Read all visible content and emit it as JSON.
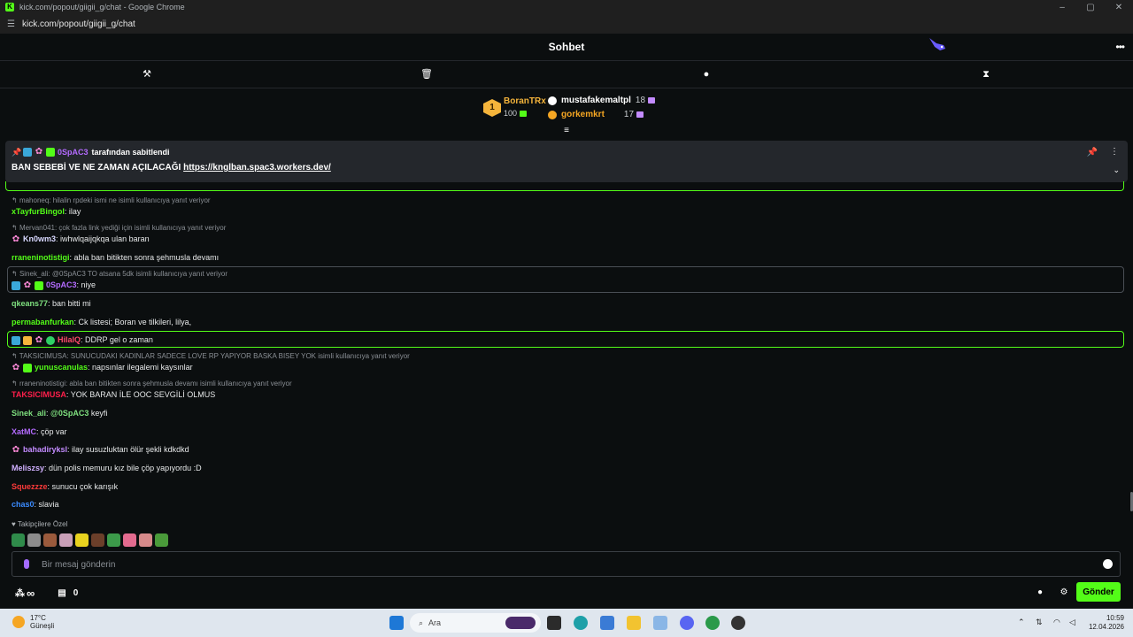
{
  "browser": {
    "window_title": "kick.com/popout/giigii_g/chat - Google Chrome",
    "url": "kick.com/popout/giigii_g/chat",
    "window_buttons": [
      "–",
      "▢",
      "✕"
    ]
  },
  "header": {
    "title": "Sohbet"
  },
  "leaderboard": {
    "first": {
      "rank": "1",
      "name": "BoranTRx",
      "value": "100"
    },
    "others": [
      {
        "name": "mustafakemaltpl",
        "value": "18",
        "color": "#ffffff"
      },
      {
        "name": "gorkemkrt",
        "value": "17",
        "color": "#f5a623"
      }
    ]
  },
  "pinned": {
    "pinner": "0SpAC3",
    "pinned_by_suffix": "tarafından sabitlendi",
    "text": "BAN SEBEBİ VE NE ZAMAN AÇILACAĞI",
    "link": "https://knglban.spac3.workers.dev/"
  },
  "messages": [
    {
      "reply": "mahoneq: hilalin rpdeki ismi ne isimli kullanıcıya yanıt veriyor",
      "user": "xTayfurBingol",
      "color": "#53fc18",
      "text": "ilay"
    },
    {
      "reply": "Mervan041: çok fazla link yediği için isimli kullanıcıya yanıt veriyor",
      "user": "Kn0wm3",
      "color": "#d8d8ff",
      "text": "iwhwlqaijqkqa ulan baran"
    },
    {
      "user": "rraneninotistigi",
      "color": "#53fc18",
      "text": "abla ban bitikten sonra şehmusla devamı"
    },
    {
      "reply": "Sinek_ali: @0SpAC3 TO atsana 5dk isimli kullanıcıya yanıt veriyor",
      "user": "0SpAC3",
      "color": "#b46bff",
      "text": "niye"
    },
    {
      "user": "qkeans77",
      "color": "#7fe07f",
      "text": "ban bitti mi"
    },
    {
      "user": "permabanfurkan",
      "color": "#53fc18",
      "text": "Ck listesi; Boran ve tilkileri, lilya,"
    },
    {
      "user": "HilalQ",
      "color": "#ff4a6b",
      "text": "DDRP gel o zaman"
    },
    {
      "reply": "TAKSICIMUSA: SUNUCUDAKI KADINLAR SADECE LOVE RP YAPIYOR BASKA BISEY YOK isimli kullanıcıya yanıt veriyor",
      "user": "yunuscanulas",
      "color": "#53fc18",
      "text": "napsınlar ilegalemi kaysınlar"
    },
    {
      "reply": "rraneninotistigi: abla ban bitikten sonra şehmusla devamı isimli kullanıcıya yanıt veriyor",
      "user": "TAKSICIMUSA",
      "color": "#ff1f4b",
      "text": "YOK BARAN İLE OOC SEVGİLİ OLMUS"
    },
    {
      "user": "Sinek_ali",
      "color": "#7fe07f",
      "text": "keyfi",
      "mention": "@0SpAC3"
    },
    {
      "user": "XatMC",
      "color": "#b46bff",
      "text": "çöp var"
    },
    {
      "user": "bahadiryksl",
      "color": "#c38bff",
      "text": "ilay susuzluktan ölür şekli kdkdkd"
    },
    {
      "user": "Meliszsy",
      "color": "#d0b0ff",
      "text": "dün polis memuru kız bile çöp yapıyordu :D"
    },
    {
      "user": "Squezzze",
      "color": "#ff3a3a",
      "text": "sunucu çok karışık"
    },
    {
      "user": "chas0",
      "color": "#3b8bff",
      "text": "slavia"
    }
  ],
  "follower_label": "Takipçilere Özel",
  "input": {
    "placeholder": "Bir mesaj gönderin",
    "value": ""
  },
  "bottom": {
    "infinity": "∞",
    "count": "0",
    "send": "Gönder"
  },
  "taskbar": {
    "temp": "17°C",
    "weather": "Güneşli",
    "search": "Ara",
    "time": "10:59",
    "date": "12.04.2026"
  },
  "colors": {
    "accent": "#53fc18",
    "background": "#0b0e0f",
    "pinned_bg": "#24272c"
  }
}
